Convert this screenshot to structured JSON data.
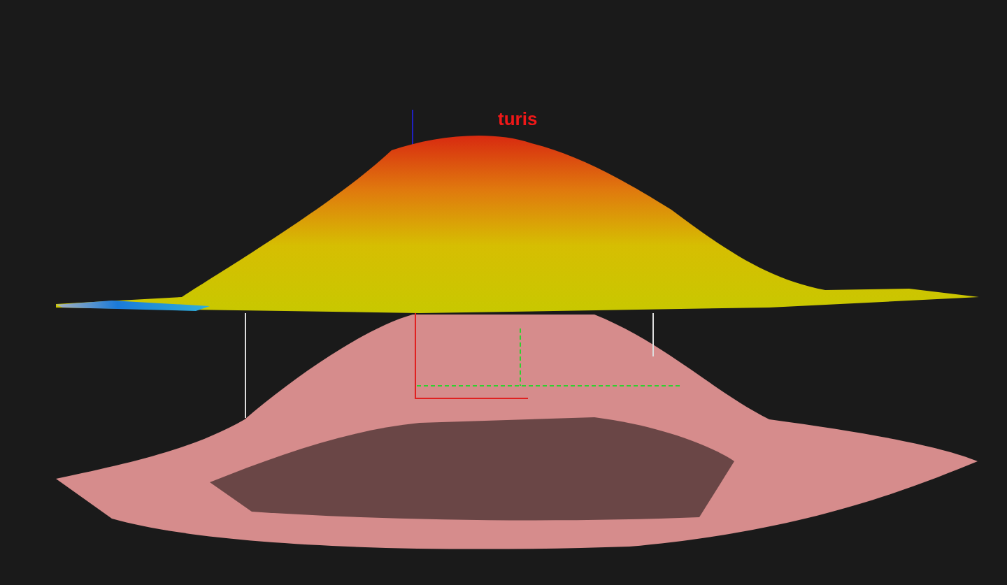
{
  "viewport": {
    "label": "turis"
  }
}
